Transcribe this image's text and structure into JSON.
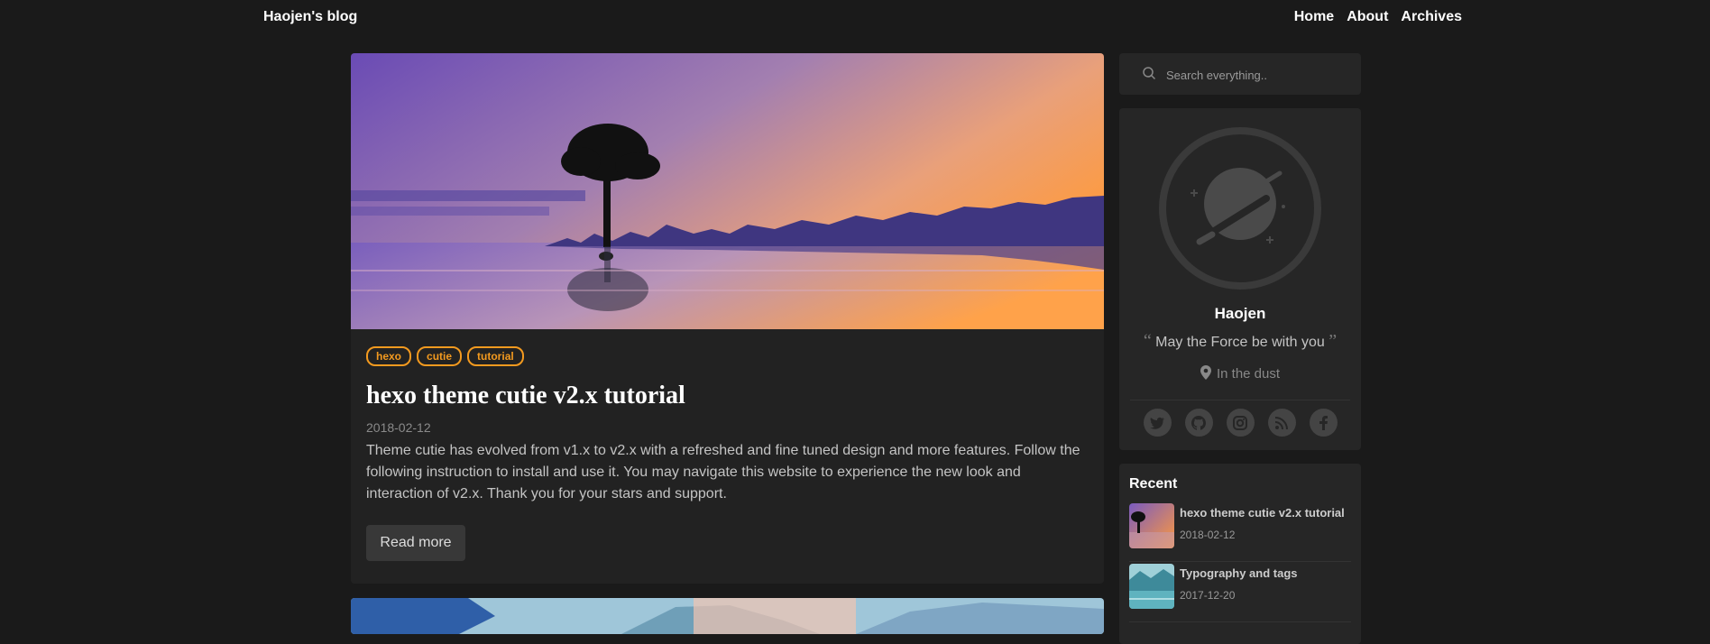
{
  "site": {
    "brand": "Haojen's blog"
  },
  "nav": {
    "items": [
      "Home",
      "About",
      "Archives"
    ]
  },
  "post": {
    "tags": [
      "hexo",
      "cutie",
      "tutorial"
    ],
    "title": "hexo theme cutie v2.x tutorial",
    "date": "2018-02-12",
    "excerpt": "Theme cutie has evolved from v1.x to v2.x with a refreshed and fine tuned design and more features. Follow the following instruction to install and use it. You may navigate this website to experience the new look and interaction of v2.x. Thank you for your stars and support.",
    "read_more": "Read more"
  },
  "search": {
    "placeholder": "Search everything.."
  },
  "profile": {
    "name": "Haojen",
    "quote_open": "“",
    "quote": "May the Force be with you",
    "quote_close": "”",
    "location": "In the dust",
    "socials": [
      "twitter-icon",
      "github-icon",
      "instagram-icon",
      "rss-icon",
      "facebook-icon"
    ]
  },
  "recent": {
    "title": "Recent",
    "items": [
      {
        "title": "hexo theme cutie v2.x tutorial",
        "date": "2018-02-12"
      },
      {
        "title": "Typography and tags",
        "date": "2017-12-20"
      }
    ]
  },
  "colors": {
    "background": "#1a1a1a",
    "card": "#222222",
    "accent": "#f39a1f"
  }
}
